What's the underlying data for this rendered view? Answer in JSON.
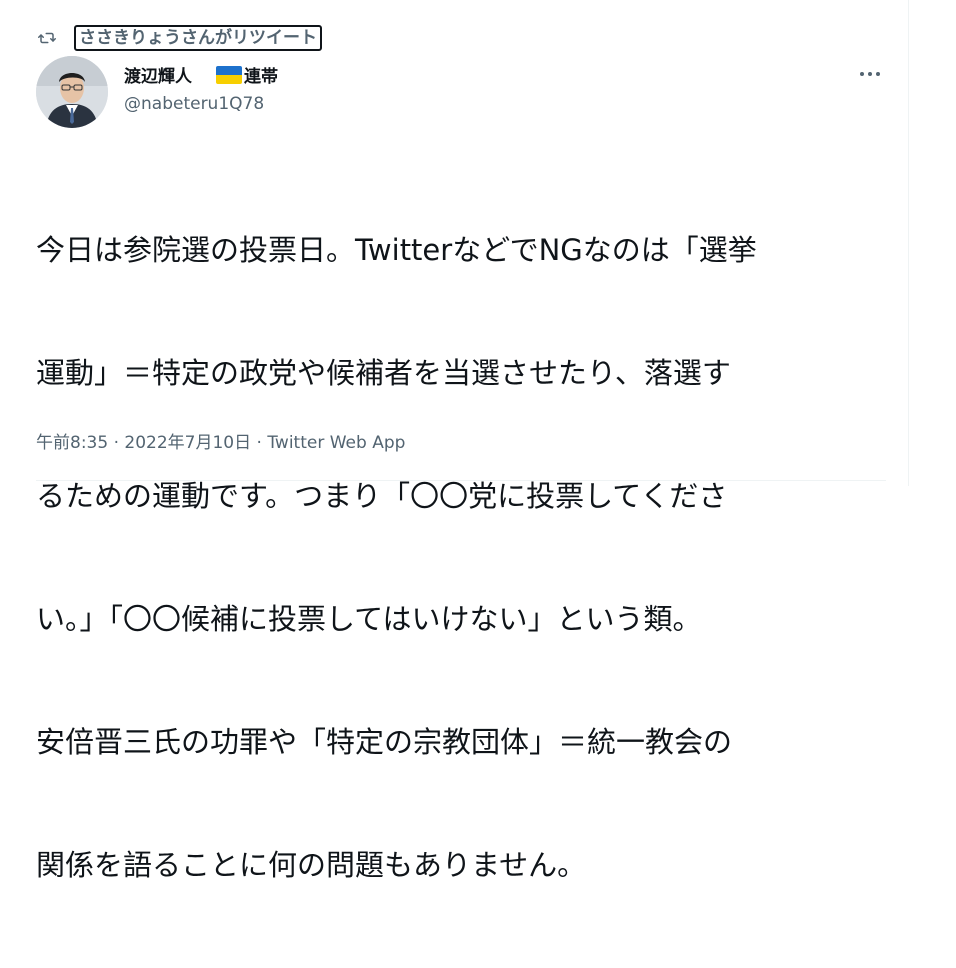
{
  "retweet": {
    "icon": "retweet-icon",
    "label": "ささきりょうさんがリツイート"
  },
  "author": {
    "name": "渡辺輝人",
    "flag_icon": "ukraine-flag-icon",
    "flag_colors": [
      "#1d71cc",
      "#f7cf00"
    ],
    "name_suffix": "連帯",
    "handle": "@nabeteru1Q78",
    "avatar": "avatar"
  },
  "more_icon": "more-options-icon",
  "tweet": {
    "text_lines": [
      "今日は参院選の投票日。TwitterなどでNGなのは「選挙",
      "運動」＝特定の政党や候補者を当選させたり、落選す",
      "るための運動です。つまり「〇〇党に投票してくださ",
      "い。」「〇〇候補に投票してはいけない」という類。",
      "安倍晋三氏の功罪や「特定の宗教団体」＝統一教会の",
      "関係を語ることに何の問題もありません。"
    ],
    "time": "午前8:35",
    "separator": " · ",
    "date": "2022年7月10日",
    "source": "Twitter Web App"
  },
  "colors": {
    "text": "#0f1419",
    "secondary": "#536471",
    "divider": "#eff3f4"
  }
}
